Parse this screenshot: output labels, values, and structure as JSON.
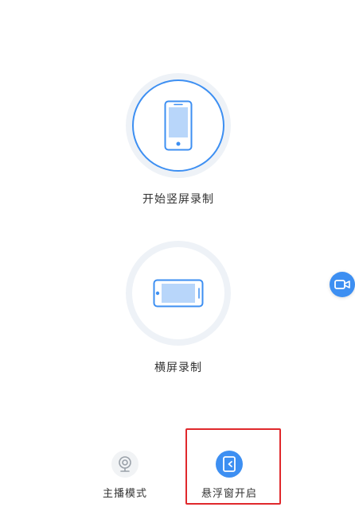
{
  "modes": {
    "portrait_label": "开始竖屏录制",
    "landscape_label": "横屏录制"
  },
  "tabs": [
    {
      "label": "主播模式",
      "icon": "webcam-icon",
      "selected": false
    },
    {
      "label": "悬浮窗开启",
      "icon": "floating-window-icon",
      "selected": true
    }
  ],
  "floating_button": {
    "icon": "video-camera-icon"
  },
  "colors": {
    "accent": "#3d8ff2",
    "screen_fill": "#b8d6fa",
    "ring": "#eef2f7",
    "highlight": "#e0282c"
  }
}
